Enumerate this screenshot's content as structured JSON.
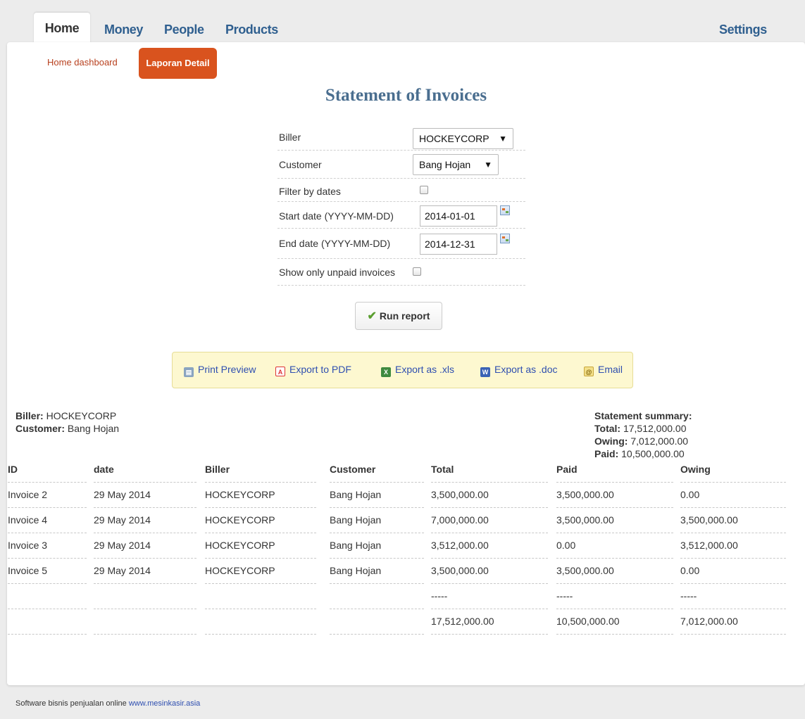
{
  "tabs": {
    "home": "Home",
    "money": "Money",
    "people": "People",
    "products": "Products",
    "settings": "Settings"
  },
  "subnav": {
    "dashboard": "Home dashboard",
    "active": "Laporan Detail"
  },
  "title": "Statement of Invoices",
  "form": {
    "biller_label": "Biller",
    "biller_value": "HOCKEYCORP",
    "customer_label": "Customer",
    "customer_value": "Bang Hojan",
    "filter_label": "Filter by dates",
    "start_label": "Start date (YYYY-MM-DD)",
    "start_value": "2014-01-01",
    "end_label": "End date (YYYY-MM-DD)",
    "end_value": "2014-12-31",
    "unpaid_label": "Show only unpaid invoices",
    "run_button": "Run report"
  },
  "export": {
    "print": "Print Preview",
    "pdf": "Export to PDF",
    "xls": "Export as .xls",
    "doc": "Export as .doc",
    "email": "Email"
  },
  "info": {
    "biller_key": "Biller:",
    "biller_val": "HOCKEYCORP",
    "customer_key": "Customer:",
    "customer_val": "Bang Hojan"
  },
  "summary": {
    "heading": "Statement summary:",
    "total_key": "Total:",
    "total_val": "17,512,000.00",
    "owing_key": "Owing:",
    "owing_val": "7,012,000.00",
    "paid_key": "Paid:",
    "paid_val": "10,500,000.00"
  },
  "table": {
    "headers": [
      "ID",
      "date",
      "Biller",
      "Customer",
      "Total",
      "Paid",
      "Owing"
    ],
    "rows": [
      [
        "Invoice 2",
        "29 May 2014",
        "HOCKEYCORP",
        "Bang Hojan",
        "3,500,000.00",
        "3,500,000.00",
        "0.00"
      ],
      [
        "Invoice 4",
        "29 May 2014",
        "HOCKEYCORP",
        "Bang Hojan",
        "7,000,000.00",
        "3,500,000.00",
        "3,500,000.00"
      ],
      [
        "Invoice 3",
        "29 May 2014",
        "HOCKEYCORP",
        "Bang Hojan",
        "3,512,000.00",
        "0.00",
        "3,512,000.00"
      ],
      [
        "Invoice 5",
        "29 May 2014",
        "HOCKEYCORP",
        "Bang Hojan",
        "3,500,000.00",
        "3,500,000.00",
        "0.00"
      ]
    ],
    "separator": [
      "",
      "",
      "",
      "",
      "-----",
      "-----",
      "-----"
    ],
    "totals": [
      "",
      "",
      "",
      "",
      "17,512,000.00",
      "10,500,000.00",
      "7,012,000.00"
    ]
  },
  "footer": {
    "text": "Software bisnis penjualan online ",
    "link": "www.mesinkasir.asia"
  }
}
